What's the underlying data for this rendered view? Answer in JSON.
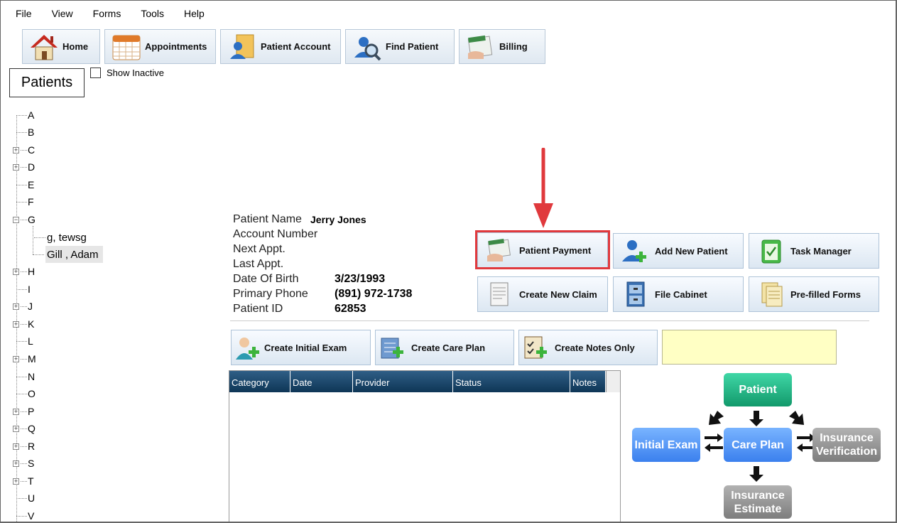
{
  "menu": [
    "File",
    "View",
    "Forms",
    "Tools",
    "Help"
  ],
  "toolbar": {
    "home": "Home",
    "appointments": "Appointments",
    "patient_account": "Patient Account",
    "find_patient": "Find Patient",
    "billing": "Billing"
  },
  "patients_panel": {
    "title": "Patients",
    "show_inactive": "Show Inactive",
    "show_inactive_checked": false,
    "letters": [
      "A",
      "B",
      "C",
      "D",
      "E",
      "F",
      "G",
      "H",
      "I",
      "J",
      "K",
      "L",
      "M",
      "N",
      "O",
      "P",
      "Q",
      "R",
      "S",
      "T",
      "U",
      "V"
    ],
    "g_children": [
      "g, tewsg",
      "Gill , Adam"
    ],
    "selected": "Gill , Adam"
  },
  "patient_info": {
    "name_label": "Patient Name",
    "name_value": "Jerry Jones",
    "account_label": "Account Number",
    "next_appt_label": "Next Appt.",
    "last_appt_label": "Last Appt.",
    "dob_label": "Date Of Birth",
    "dob_value": "3/23/1993",
    "phone_label": "Primary Phone",
    "phone_value": "(891) 972-1738",
    "id_label": "Patient ID",
    "id_value": "62853"
  },
  "actions": {
    "patient_payment": "Patient Payment",
    "add_new_patient": "Add New Patient",
    "task_manager": "Task Manager",
    "create_new_claim": "Create New Claim",
    "file_cabinet": "File Cabinet",
    "prefilled_forms": "Pre-filled Forms",
    "create_initial_exam": "Create Initial Exam",
    "create_care_plan": "Create Care Plan",
    "create_notes_only": "Create Notes Only"
  },
  "grid": {
    "columns": [
      "Category",
      "Date",
      "Provider",
      "Status",
      "Notes"
    ]
  },
  "workflow": {
    "patient": "Patient",
    "initial_exam": "Initial Exam",
    "care_plan": "Care Plan",
    "insurance_verification": "Insurance Verification",
    "insurance_estimate": "Insurance Estimate"
  },
  "colors": {
    "highlight": "#e0393d",
    "grid_header": "#0e3656",
    "workflow_green": "#12996b",
    "workflow_blue": "#3b80ee",
    "workflow_gray": "#7d7d7d"
  }
}
